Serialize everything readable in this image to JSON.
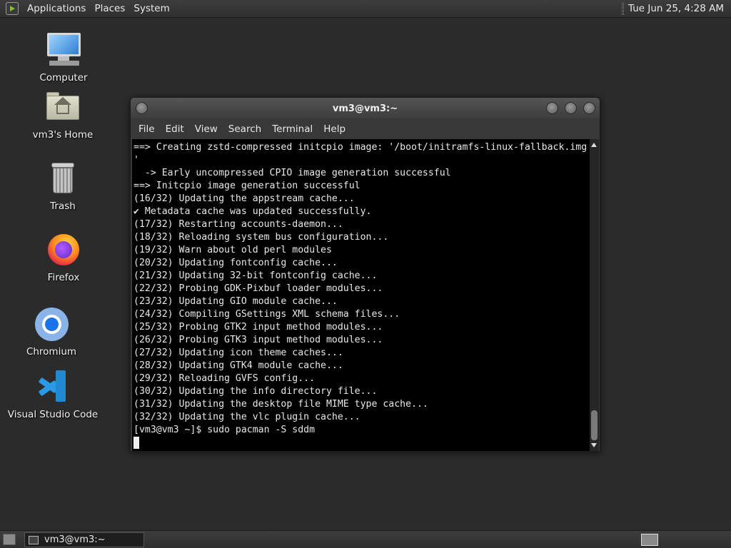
{
  "top_panel": {
    "menus": [
      "Applications",
      "Places",
      "System"
    ],
    "clock": "Tue Jun 25,  4:28 AM"
  },
  "desktop": {
    "icons": [
      {
        "label": "Computer",
        "icon": "computer-icon"
      },
      {
        "label": "vm3's Home",
        "icon": "home-folder-icon"
      },
      {
        "label": "Trash",
        "icon": "trash-icon"
      },
      {
        "label": "Firefox",
        "icon": "firefox-icon"
      },
      {
        "label": "Chromium",
        "icon": "chromium-icon"
      },
      {
        "label": "Visual Studio Code",
        "icon": "vscode-icon"
      }
    ]
  },
  "terminal": {
    "title": "vm3@vm3:~",
    "menu": [
      "File",
      "Edit",
      "View",
      "Search",
      "Terminal",
      "Help"
    ],
    "lines": [
      "==> Creating zstd-compressed initcpio image: '/boot/initramfs-linux-fallback.img",
      "'",
      "  -> Early uncompressed CPIO image generation successful",
      "==> Initcpio image generation successful",
      "(16/32) Updating the appstream cache...",
      "✔ Metadata cache was updated successfully.",
      "(17/32) Restarting accounts-daemon...",
      "(18/32) Reloading system bus configuration...",
      "(19/32) Warn about old perl modules",
      "(20/32) Updating fontconfig cache...",
      "(21/32) Updating 32-bit fontconfig cache...",
      "(22/32) Probing GDK-Pixbuf loader modules...",
      "(23/32) Updating GIO module cache...",
      "(24/32) Compiling GSettings XML schema files...",
      "(25/32) Probing GTK2 input method modules...",
      "(26/32) Probing GTK3 input method modules...",
      "(27/32) Updating icon theme caches...",
      "(28/32) Updating GTK4 module cache...",
      "(29/32) Reloading GVFS config...",
      "(30/32) Updating the info directory file...",
      "(31/32) Updating the desktop file MIME type cache...",
      "(32/32) Updating the vlc plugin cache...",
      "[vm3@vm3 ~]$ sudo pacman -S sddm"
    ]
  },
  "taskbar": {
    "task_label": "vm3@vm3:~"
  }
}
